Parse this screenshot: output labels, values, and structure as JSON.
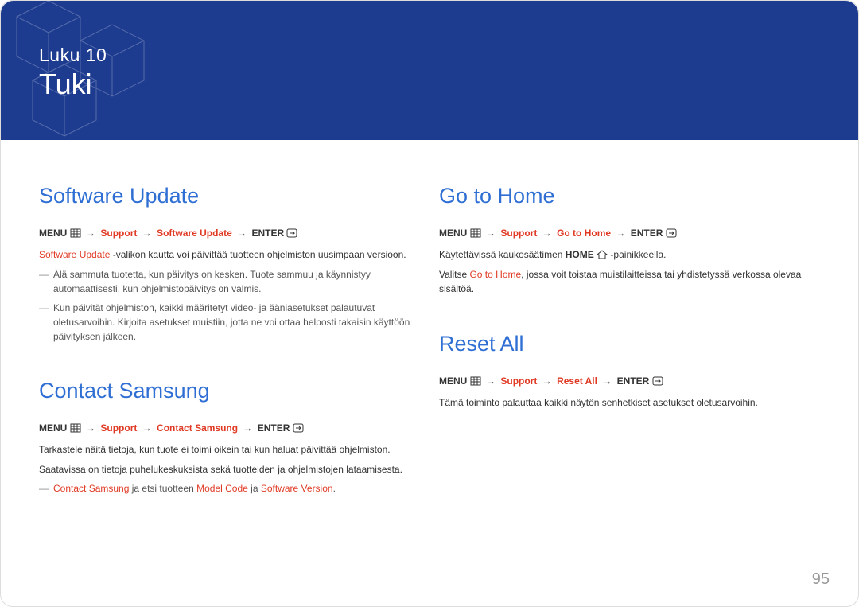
{
  "banner": {
    "chapter": "Luku 10",
    "title": "Tuki"
  },
  "sections": {
    "software_update": {
      "heading": "Software Update",
      "path": {
        "menu": "MENU",
        "support": "Support",
        "item": "Software Update",
        "enter": "ENTER"
      },
      "lead_red": "Software Update",
      "lead_rest": " -valikon kautta voi päivittää tuotteen ohjelmiston uusimpaan versioon.",
      "note1": "Älä sammuta tuotetta, kun päivitys on kesken. Tuote sammuu ja käynnistyy automaattisesti, kun ohjelmistopäivitys on valmis.",
      "note2": "Kun päivität ohjelmiston, kaikki määritetyt video- ja ääniasetukset palautuvat oletusarvoihin. Kirjoita asetukset muistiin, jotta ne voi ottaa helposti takaisin käyttöön päivityksen jälkeen."
    },
    "contact_samsung": {
      "heading": "Contact Samsung",
      "path": {
        "menu": "MENU",
        "support": "Support",
        "item": "Contact Samsung",
        "enter": "ENTER"
      },
      "p1": "Tarkastele näitä tietoja, kun tuote ei toimi oikein tai kun haluat päivittää ohjelmiston.",
      "p2": "Saatavissa on tietoja puhelukeskuksista sekä tuotteiden ja ohjelmistojen lataamisesta.",
      "note_red1": "Contact Samsung",
      "note_mid": " ja etsi tuotteen ",
      "note_red2": "Model Code",
      "note_mid2": " ja ",
      "note_red3": "Software Version",
      "note_end": "."
    },
    "go_to_home": {
      "heading": "Go to Home",
      "path": {
        "menu": "MENU",
        "support": "Support",
        "item": "Go to Home",
        "enter": "ENTER"
      },
      "p1_a": "Käytettävissä kaukosäätimen ",
      "p1_bold": "HOME",
      "p1_b": " -painikkeella.",
      "p2_a": "Valitse ",
      "p2_red": "Go to Home",
      "p2_b": ", jossa voit toistaa muistilaitteissa tai yhdistetyssä verkossa olevaa sisältöä."
    },
    "reset_all": {
      "heading": "Reset All",
      "path": {
        "menu": "MENU",
        "support": "Support",
        "item": "Reset All",
        "enter": "ENTER"
      },
      "p1": "Tämä toiminto palauttaa kaikki näytön senhetkiset asetukset oletusarvoihin."
    }
  },
  "page_number": "95",
  "glyphs": {
    "arrow": "→"
  }
}
